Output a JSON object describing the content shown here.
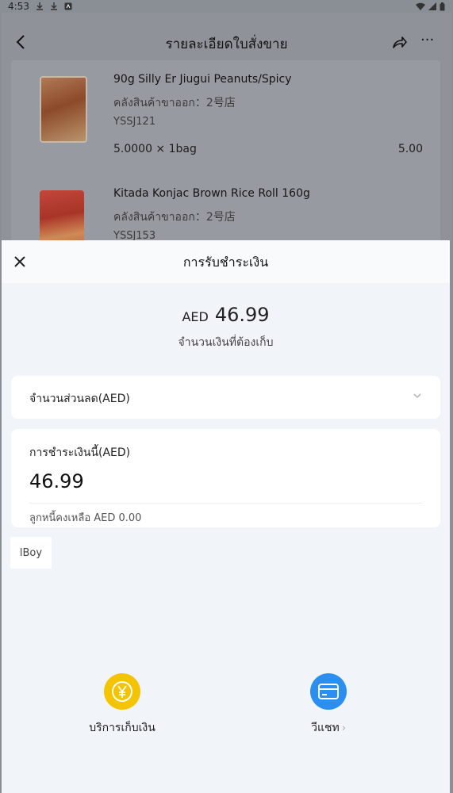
{
  "status_bar": {
    "time": "4:53"
  },
  "nav": {
    "title": "รายละเอียดใบสั่งขาย"
  },
  "items": [
    {
      "name": "90g Silly Er Jiugui Peanuts/Spicy",
      "warehouse": "คลังสินค้าขาออก：2号店",
      "code": "YSSJ121",
      "qty": "5.0000 × 1bag",
      "amount": "5.00"
    },
    {
      "name": "Kitada Konjac Brown Rice Roll 160g",
      "warehouse": "คลังสินค้าขาออก：2号店",
      "code": "YSSJ153"
    }
  ],
  "sheet": {
    "title": "การรับชำระเงิน",
    "currency": "AED",
    "total": "46.99",
    "total_label": "จำนวนเงินที่ต้องเก็บ",
    "discount_label": "จำนวนส่วนลด(AED)",
    "payment_label": "การชำระเงินนี้(AED)",
    "payment_value": "46.99",
    "debt_text": "ลูกหนี้คงเหลือ AED 0.00",
    "tag": "lBoy"
  },
  "pay_methods": [
    {
      "label": "บริการเก็บเงิน",
      "icon": "yen-icon",
      "color": "#f5c400"
    },
    {
      "label": "วีแชท",
      "icon": "card-icon",
      "color": "#2b8ff0"
    }
  ]
}
